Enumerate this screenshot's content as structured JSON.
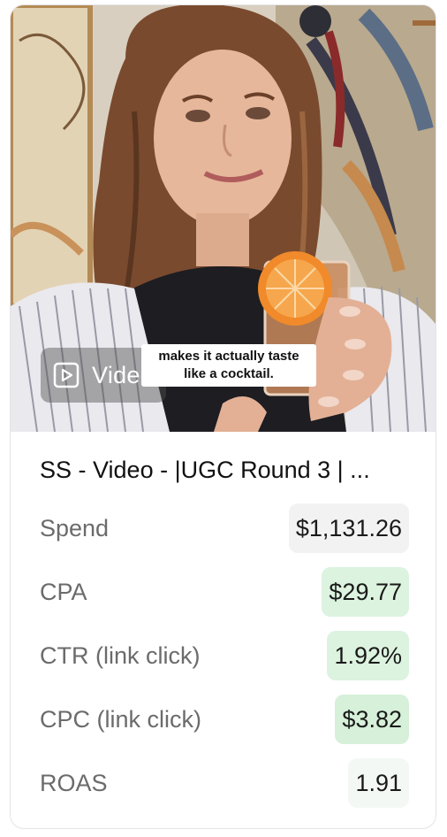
{
  "media": {
    "badge_label": "Video",
    "badge_icon": "play-square-icon",
    "caption_line1": "makes it actually taste",
    "caption_line2": "like a cocktail."
  },
  "ad": {
    "title": "SS - Video - |UGC Round 3 | ..."
  },
  "metrics": [
    {
      "label": "Spend",
      "value": "$1,131.26",
      "bg": "#f2f2f2"
    },
    {
      "label": "CPA",
      "value": "$29.77",
      "bg": "#dcf3df"
    },
    {
      "label": "CTR (link click)",
      "value": "1.92%",
      "bg": "#dcf3df"
    },
    {
      "label": "CPC (link click)",
      "value": "$3.82",
      "bg": "#d6f0d9"
    },
    {
      "label": "ROAS",
      "value": "1.91",
      "bg": "#f4f8f4"
    }
  ]
}
